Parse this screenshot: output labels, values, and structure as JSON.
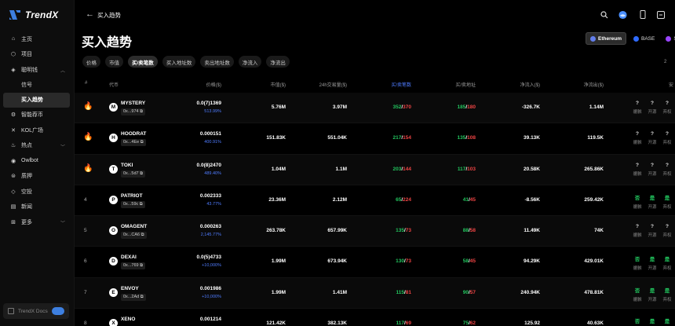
{
  "app": {
    "name": "TrendX"
  },
  "sidebar": {
    "items": [
      {
        "label": "主页",
        "icon": "home-icon"
      },
      {
        "label": "项目",
        "icon": "box-icon"
      },
      {
        "label": "聪明钱",
        "icon": "money-icon",
        "expanded": true
      }
    ],
    "sub_items": [
      {
        "label": "信号"
      },
      {
        "label": "买入趋势",
        "active": true
      }
    ],
    "items_after": [
      {
        "label": "智能荐币",
        "icon": "robot-icon"
      },
      {
        "label": "KOL广场",
        "icon": "x-icon"
      },
      {
        "label": "热点",
        "icon": "flame-icon"
      },
      {
        "label": "Owlbot",
        "icon": "owl-icon"
      },
      {
        "label": "质押",
        "icon": "stake-icon"
      },
      {
        "label": "空投",
        "icon": "airdrop-icon"
      },
      {
        "label": "新闻",
        "icon": "news-icon"
      },
      {
        "label": "更多",
        "icon": "grid-icon"
      }
    ],
    "docs_label": "TrendX Docs"
  },
  "header": {
    "breadcrumb": "买入趋势",
    "title": "买入趋势"
  },
  "chains": [
    {
      "label": "Ethereum",
      "color": "#627eea",
      "active": true
    },
    {
      "label": "BASE",
      "color": "#2f6bff",
      "active": false
    },
    {
      "label": "So",
      "color": "#9945ff",
      "active": false
    }
  ],
  "filters": [
    "价格",
    "市值",
    "买/卖笔数",
    "买入地址数",
    "卖出地址数",
    "净流入",
    "净流出"
  ],
  "active_filter": 2,
  "right_num": "2",
  "columns": {
    "rank": "#",
    "token": "代币",
    "price": "价格($)",
    "mcap": "市值($)",
    "volume": "24h交易量($)",
    "buy_sell": "买/卖笔数",
    "buy_sell_addr": "买/卖地址",
    "net_in": "净流入($)",
    "net_out": "净流出($)",
    "security": "安"
  },
  "security_labels": [
    "貔貅",
    "开源",
    "弃权"
  ],
  "rows": [
    {
      "rank": "1",
      "hot": true,
      "letter": "M",
      "name": "MYSTERY",
      "addr": "0x...974",
      "price": "0.0(7)1369",
      "change": "513.99%",
      "mcap": "5.76M",
      "vol": "3.97M",
      "buys": "352",
      "sells": "370",
      "buy_addr": "185",
      "sell_addr": "180",
      "net_in": "-326.7K",
      "net_out": "1.14M",
      "sec": [
        "?",
        "?",
        "?"
      ]
    },
    {
      "rank": "2",
      "hot": true,
      "letter": "H",
      "name": "HOODRAT",
      "addr": "0x...4Ee",
      "price": "0.000151",
      "change": "400.91%",
      "mcap": "151.83K",
      "vol": "551.04K",
      "buys": "217",
      "sells": "154",
      "buy_addr": "135",
      "sell_addr": "108",
      "net_in": "39.13K",
      "net_out": "119.5K",
      "sec": [
        "?",
        "?",
        "?"
      ]
    },
    {
      "rank": "3",
      "hot": true,
      "letter": "T",
      "name": "TOKI",
      "addr": "0x...5d7",
      "price": "0.0(8)2470",
      "change": "489.40%",
      "mcap": "1.04M",
      "vol": "1.1M",
      "buys": "203",
      "sells": "144",
      "buy_addr": "117",
      "sell_addr": "103",
      "net_in": "20.58K",
      "net_out": "265.86K",
      "sec": [
        "?",
        "?",
        "?"
      ]
    },
    {
      "rank": "4",
      "hot": false,
      "letter": "P",
      "name": "PATRIOT",
      "addr": "0x...59c",
      "price": "0.002333",
      "change": "43.77%",
      "mcap": "23.36M",
      "vol": "2.12M",
      "buys": "65",
      "sells": "224",
      "buy_addr": "41",
      "sell_addr": "45",
      "net_in": "-8.56K",
      "net_out": "259.42K",
      "sec": [
        "否",
        "是",
        "是"
      ]
    },
    {
      "rank": "5",
      "hot": false,
      "letter": "O",
      "name": "OMAGENT",
      "addr": "0x...CA6",
      "price": "0.000263",
      "change": "2,145.77%",
      "mcap": "263.78K",
      "vol": "657.99K",
      "buys": "135",
      "sells": "73",
      "buy_addr": "88",
      "sell_addr": "58",
      "net_in": "11.49K",
      "net_out": "74K",
      "sec": [
        "?",
        "?",
        "?"
      ]
    },
    {
      "rank": "6",
      "hot": false,
      "letter": "D",
      "name": "DEXAI",
      "addr": "0x...769",
      "price": "0.0(5)4733",
      "change": "+10,000%",
      "mcap": "1.99M",
      "vol": "673.94K",
      "buys": "130",
      "sells": "73",
      "buy_addr": "58",
      "sell_addr": "45",
      "net_in": "94.29K",
      "net_out": "429.01K",
      "sec": [
        "否",
        "是",
        "是"
      ]
    },
    {
      "rank": "7",
      "hot": false,
      "letter": "E",
      "name": "ENVOY",
      "addr": "0x...2Ad",
      "price": "0.001986",
      "change": "+10,000%",
      "mcap": "1.99M",
      "vol": "1.41M",
      "buys": "115",
      "sells": "81",
      "buy_addr": "90",
      "sell_addr": "57",
      "net_in": "240.94K",
      "net_out": "478.81K",
      "sec": [
        "否",
        "是",
        "是"
      ]
    },
    {
      "rank": "8",
      "hot": false,
      "letter": "X",
      "name": "XENO",
      "addr": "",
      "price": "0.001214",
      "change": "",
      "mcap": "121.42K",
      "vol": "382.13K",
      "buys": "117",
      "sells": "69",
      "buy_addr": "75",
      "sell_addr": "62",
      "net_in": "125.92",
      "net_out": "40.63K",
      "sec": [
        "否",
        "是",
        "是"
      ]
    }
  ]
}
